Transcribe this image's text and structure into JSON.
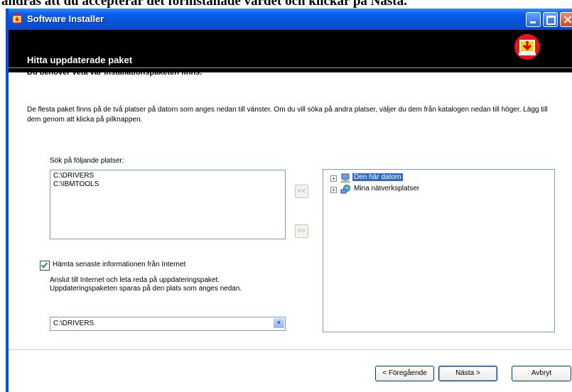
{
  "background_text": "ändras att du accepterar det förinstallade värdet och klickar på Nästa.",
  "window": {
    "title": "Software Installer"
  },
  "header": {
    "title": "Hitta uppdaterade paket"
  },
  "subheading": "Du behöver veta var installationspaketen finns.",
  "description": "De flesta paket finns på de två platser på datorn som anges nedan till vänster.  Om du vill söka på andra platser, väljer du dem från katalogen nedan till höger.  Lägg till dem genom att klicka på pilknappen.",
  "search_locations": {
    "label": "Sök på följande platser:",
    "items": [
      "C:\\DRIVERS",
      "C:\\IBMTOOLS"
    ]
  },
  "arrows": {
    "add": "<<",
    "remove": ">>"
  },
  "tree": [
    {
      "label": "Den här datorn",
      "selected": true,
      "icon": "computer-icon"
    },
    {
      "label": "Mina nätverksplatser",
      "selected": false,
      "icon": "network-places-icon"
    }
  ],
  "internet": {
    "checkbox_label": "Hämta senaste informationen från Internet",
    "checked": true,
    "note": "Anslut till Internet och leta reda på uppdateringspaket. Uppdateringspaketen sparas på den plats som anges nedan."
  },
  "save_location": {
    "value": "C:\\DRIVERS"
  },
  "buttons": {
    "back": "< Föregående",
    "next": "Nästa >",
    "cancel": "Avbryt"
  },
  "colors": {
    "titlebar": "#0552d8",
    "header": "#000000",
    "badge": "#e8131b",
    "selection": "#316ac5"
  }
}
